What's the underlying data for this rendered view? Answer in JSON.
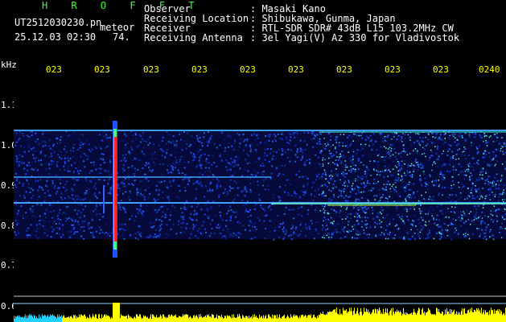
{
  "header": {
    "title": "H R O F F T",
    "filename": "UT2512030230.pn",
    "meteor_label": "meteor",
    "datetime": "25.12.03 02:30",
    "count": "74.",
    "info": [
      {
        "label": "Observer",
        "value": ": Masaki Kano"
      },
      {
        "label": "Receiving Location",
        "value": ": Shibukawa, Gunma, Japan"
      },
      {
        "label": "Receiver",
        "value": ": RTL-SDR SDR# 43dB L15 103.2MHz CW"
      },
      {
        "label": "Receiving Antenna",
        "value": ": 3el Yagi(V) Az 330 for Vladivostok"
      }
    ]
  },
  "axis": {
    "unit": "kHz",
    "y_ticks": [
      "1.1",
      "1.0",
      "0.9",
      "0.8",
      "0.7",
      "0.6"
    ],
    "time_ticks": [
      "023",
      "023",
      "023",
      "023",
      "023",
      "023",
      "023",
      "023",
      "023",
      "0240"
    ]
  },
  "colors": {
    "background": "#000000",
    "title_green": "#3dff3d",
    "tick_yellow": "#ffff00",
    "noise_blue": "#1030c0",
    "meteor_red": "#ff2020",
    "baseline_cyan": "#20d0ff"
  }
}
